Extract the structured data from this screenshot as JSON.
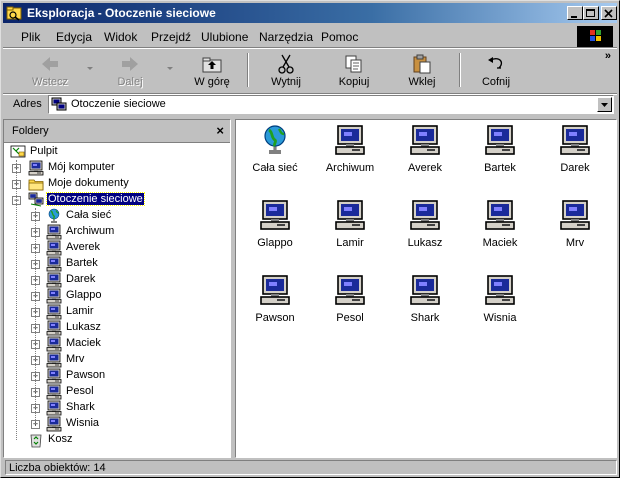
{
  "window": {
    "title": "Eksploracja - Otoczenie sieciowe"
  },
  "menu": [
    {
      "name": "menu-plik",
      "label": "Plik"
    },
    {
      "name": "menu-edycja",
      "label": "Edycja"
    },
    {
      "name": "menu-widok",
      "label": "Widok"
    },
    {
      "name": "menu-przejdz",
      "label": "Przejdź"
    },
    {
      "name": "menu-ulubione",
      "label": "Ulubione"
    },
    {
      "name": "menu-narzedzia",
      "label": "Narzędzia"
    },
    {
      "name": "menu-pomoc",
      "label": "Pomoc"
    }
  ],
  "toolbar": {
    "back": "Wstecz",
    "forward": "Dalej",
    "up": "W górę",
    "cut": "Wytnij",
    "copy": "Kopiuj",
    "paste": "Wklej",
    "undo": "Cofnij",
    "more": "»"
  },
  "address": {
    "label": "Adres",
    "value": "Otoczenie sieciowe"
  },
  "folders_pane": {
    "title": "Foldery",
    "close": "×",
    "tree": [
      {
        "label": "Pulpit",
        "icon": "desktop-icon",
        "level": 0,
        "expander": ""
      },
      {
        "label": "Mój komputer",
        "icon": "my-computer-icon",
        "level": 1,
        "expander": "+"
      },
      {
        "label": "Moje dokumenty",
        "icon": "folder-icon",
        "level": 1,
        "expander": "+"
      },
      {
        "label": "Otoczenie sieciowe",
        "icon": "network-icon",
        "level": 1,
        "expander": "-",
        "selected": true
      },
      {
        "label": "Cała sieć",
        "icon": "globe-icon",
        "level": 2,
        "expander": "+"
      },
      {
        "label": "Archiwum",
        "icon": "computer-icon",
        "level": 2,
        "expander": "+"
      },
      {
        "label": "Averek",
        "icon": "computer-icon",
        "level": 2,
        "expander": "+"
      },
      {
        "label": "Bartek",
        "icon": "computer-icon",
        "level": 2,
        "expander": "+"
      },
      {
        "label": "Darek",
        "icon": "computer-icon",
        "level": 2,
        "expander": "+"
      },
      {
        "label": "Glappo",
        "icon": "computer-icon",
        "level": 2,
        "expander": "+"
      },
      {
        "label": "Lamir",
        "icon": "computer-icon",
        "level": 2,
        "expander": "+"
      },
      {
        "label": "Lukasz",
        "icon": "computer-icon",
        "level": 2,
        "expander": "+"
      },
      {
        "label": "Maciek",
        "icon": "computer-icon",
        "level": 2,
        "expander": "+"
      },
      {
        "label": "Mrv",
        "icon": "computer-icon",
        "level": 2,
        "expander": "+"
      },
      {
        "label": "Pawson",
        "icon": "computer-icon",
        "level": 2,
        "expander": "+"
      },
      {
        "label": "Pesol",
        "icon": "computer-icon",
        "level": 2,
        "expander": "+"
      },
      {
        "label": "Shark",
        "icon": "computer-icon",
        "level": 2,
        "expander": "+"
      },
      {
        "label": "Wisnia",
        "icon": "computer-icon",
        "level": 2,
        "expander": "+"
      },
      {
        "label": "Kosz",
        "icon": "recycle-bin-icon",
        "level": 1,
        "expander": ""
      }
    ]
  },
  "content": {
    "items": [
      {
        "label": "Cała sieć",
        "icon": "globe-icon"
      },
      {
        "label": "Archiwum",
        "icon": "computer-icon"
      },
      {
        "label": "Averek",
        "icon": "computer-icon"
      },
      {
        "label": "Bartek",
        "icon": "computer-icon"
      },
      {
        "label": "Darek",
        "icon": "computer-icon"
      },
      {
        "label": "Glappo",
        "icon": "computer-icon"
      },
      {
        "label": "Lamir",
        "icon": "computer-icon"
      },
      {
        "label": "Lukasz",
        "icon": "computer-icon"
      },
      {
        "label": "Maciek",
        "icon": "computer-icon"
      },
      {
        "label": "Mrv",
        "icon": "computer-icon"
      },
      {
        "label": "Pawson",
        "icon": "computer-icon"
      },
      {
        "label": "Pesol",
        "icon": "computer-icon"
      },
      {
        "label": "Shark",
        "icon": "computer-icon"
      },
      {
        "label": "Wisnia",
        "icon": "computer-icon"
      }
    ]
  },
  "status": {
    "text": "Liczba obiektów: 14"
  },
  "colors": {
    "titlebar": "#0a246a",
    "selection": "#000080",
    "face": "#c0c0c0"
  }
}
